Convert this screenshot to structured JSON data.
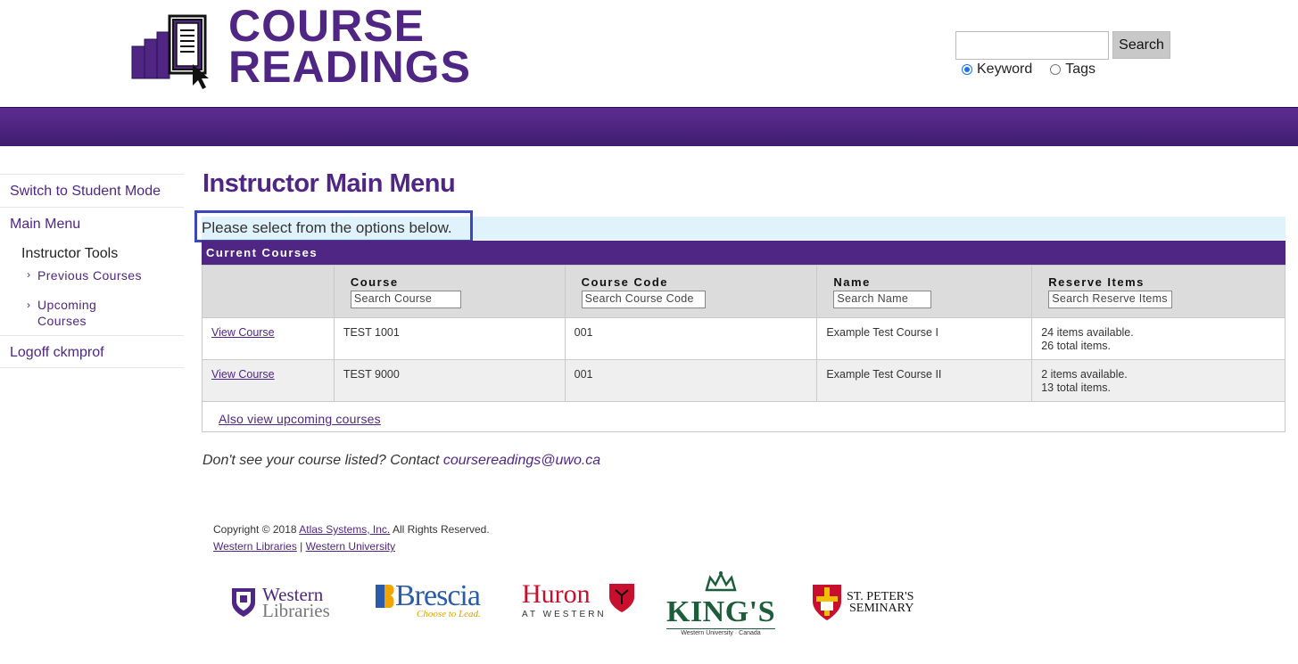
{
  "header": {
    "logo_line1": "COURSE",
    "logo_line2": "READINGS",
    "search": {
      "button_label": "Search",
      "value": ""
    },
    "search_modes": [
      {
        "label": "Keyword",
        "selected": true
      },
      {
        "label": "Tags",
        "selected": false
      }
    ]
  },
  "sidebar": {
    "switch_mode": "Switch to Student Mode",
    "main_menu": "Main Menu",
    "instructor_tools": "Instructor Tools",
    "previous_courses": "Previous Courses",
    "upcoming_courses_line1": "Upcoming",
    "upcoming_courses_line2": "Courses",
    "logoff": "Logoff ckmprof"
  },
  "main": {
    "title": "Instructor Main Menu",
    "notice": "Please select from the options below.",
    "table_title": "Current Courses",
    "columns": [
      {
        "label": "",
        "placeholder": ""
      },
      {
        "label": "Course",
        "placeholder": "Search Course"
      },
      {
        "label": "Course Code",
        "placeholder": "Search Course Code"
      },
      {
        "label": "Name",
        "placeholder": "Search Name"
      },
      {
        "label": "Reserve Items",
        "placeholder": "Search Reserve Items"
      }
    ],
    "rows": [
      {
        "action": "View Course",
        "course": "TEST 1001",
        "code": "001",
        "name": "Example Test Course I",
        "available": "24 items available.",
        "total": "26 total items."
      },
      {
        "action": "View Course",
        "course": "TEST 9000",
        "code": "001",
        "name": "Example Test Course II",
        "available": "2 items available.",
        "total": "13 total items."
      }
    ],
    "upcoming_link": "Also view upcoming courses",
    "contact_prefix": "Don't see your course listed? Contact ",
    "contact_email": "coursereadings@uwo.ca"
  },
  "footer": {
    "copyright_prefix": "Copyright © 2018 ",
    "copyright_company": "Atlas Systems, Inc.",
    "copyright_suffix": " All Rights Reserved.",
    "link_libraries": "Western Libraries",
    "separator": " | ",
    "link_university": "Western University",
    "logos": {
      "western_line1": "Western",
      "western_line2": "Libraries",
      "brescia_name": "Brescia",
      "brescia_tag": "Choose to Lead.",
      "huron_name": "Huron",
      "huron_sub": "AT WESTERN",
      "kings_name": "KING'S",
      "kings_sub": "Western University · Canada",
      "stpeters_line1": "ST. PETER'S",
      "stpeters_line2": "SEMINARY"
    }
  },
  "colors": {
    "brand_purple": "#4f2683",
    "notice_bg": "#e0f2fb",
    "highlight_border": "#3a47b7"
  }
}
